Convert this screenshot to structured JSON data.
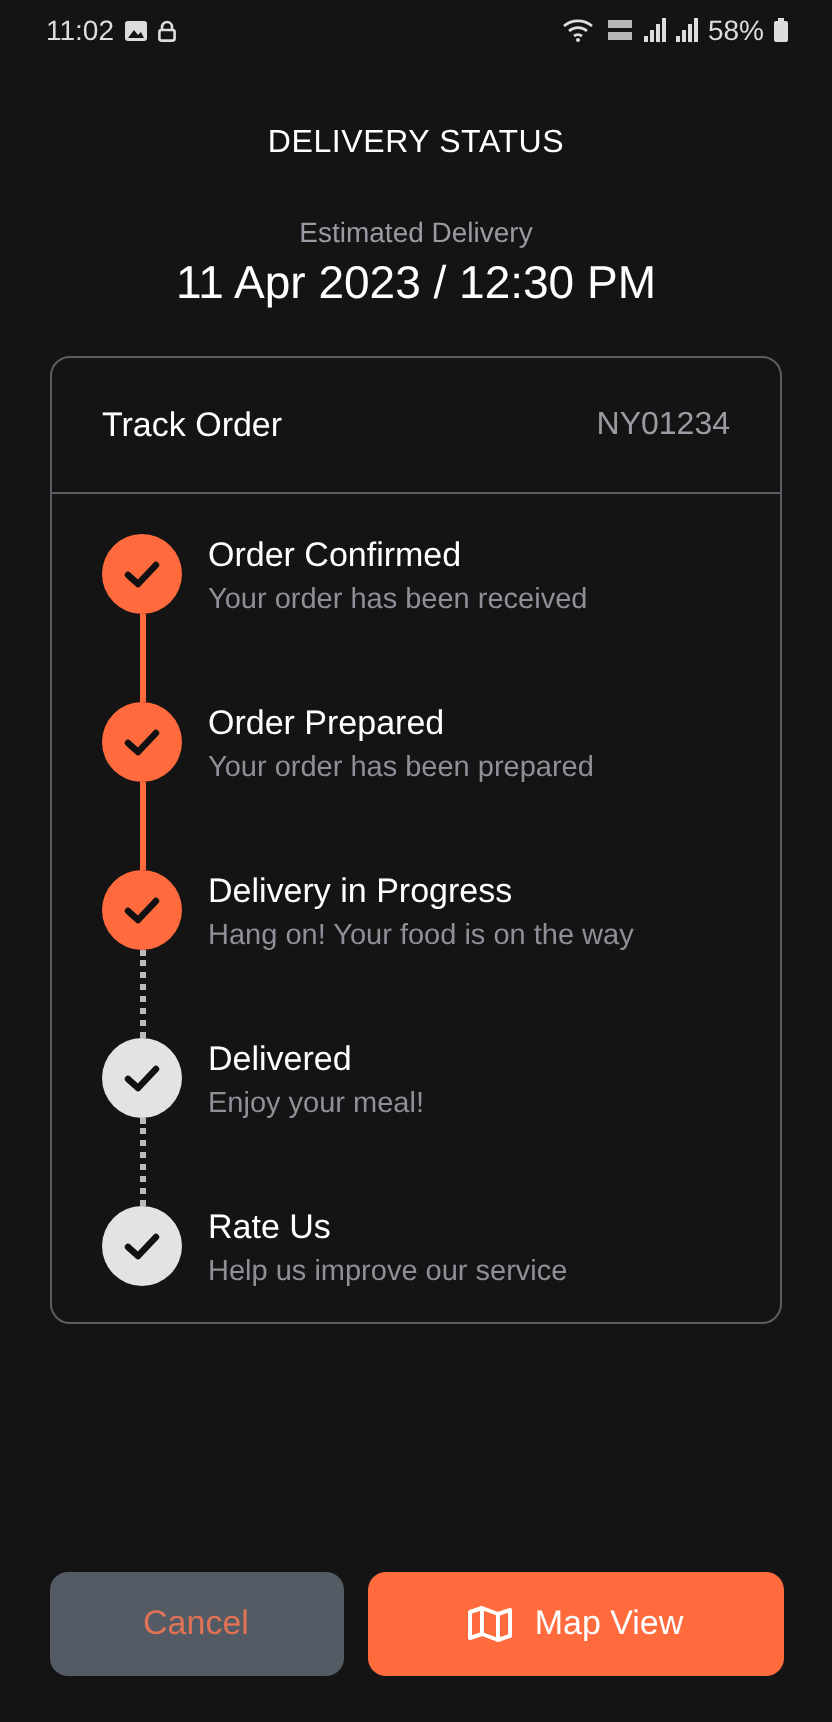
{
  "status_bar": {
    "time": "11:02",
    "battery": "58%"
  },
  "title": "DELIVERY STATUS",
  "estimate": {
    "label": "Estimated Delivery",
    "value": "11 Apr 2023 / 12:30 PM"
  },
  "card": {
    "title": "Track Order",
    "order_id": "NY01234"
  },
  "steps": [
    {
      "title": "Order Confirmed",
      "subtitle": "Your order has been received",
      "done": true
    },
    {
      "title": "Order Prepared",
      "subtitle": "Your order has been prepared",
      "done": true
    },
    {
      "title": "Delivery in Progress",
      "subtitle": "Hang on! Your food is on the way",
      "done": true
    },
    {
      "title": "Delivered",
      "subtitle": "Enjoy your meal!",
      "done": false
    },
    {
      "title": "Rate Us",
      "subtitle": "Help us improve our service",
      "done": false
    }
  ],
  "buttons": {
    "cancel": "Cancel",
    "map": "Map View"
  }
}
